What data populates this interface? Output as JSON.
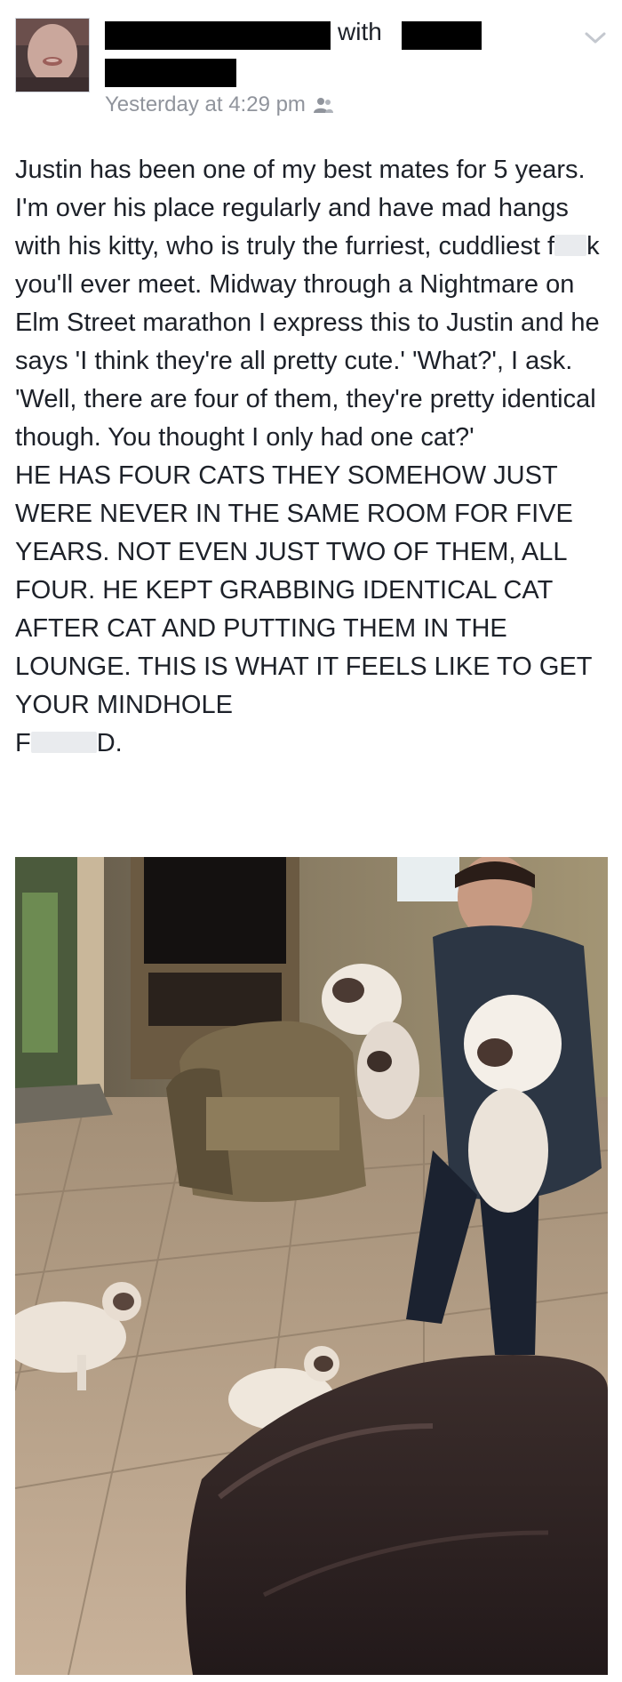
{
  "post": {
    "with_label": "with",
    "timestamp": "Yesterday at 4:29 pm",
    "audience_icon": "friends-icon",
    "options_icon": "chevron-down-icon",
    "body_line_1": "Justin has been one of my best mates for 5 years. I'm over his place regularly and have mad hangs with his kitty, who is truly the furriest, cuddliest f",
    "body_line_2": "k you'll ever meet. Midway through a Nightmare on Elm Street marathon I express this to Justin and he says 'I think they're all pretty cute.' 'What?', I ask. 'Well, there are four of them, they're pretty identical though. You thought I only had one cat?'",
    "caps_text": "HE HAS FOUR CATS THEY SOMEHOW JUST WERE NEVER IN THE SAME ROOM FOR FIVE YEARS. NOT EVEN JUST TWO OF THEM, ALL FOUR. HE KEPT GRABBING IDENTICAL CAT AFTER CAT AND PUTTING THEM IN THE LOUNGE. THIS IS WHAT IT FEELS LIKE TO GET YOUR MINDHOLE",
    "caps_end_start": "F",
    "caps_end_finish": "D."
  },
  "colors": {
    "text": "#1d2129",
    "meta": "#90949c",
    "redaction": "#000000"
  }
}
